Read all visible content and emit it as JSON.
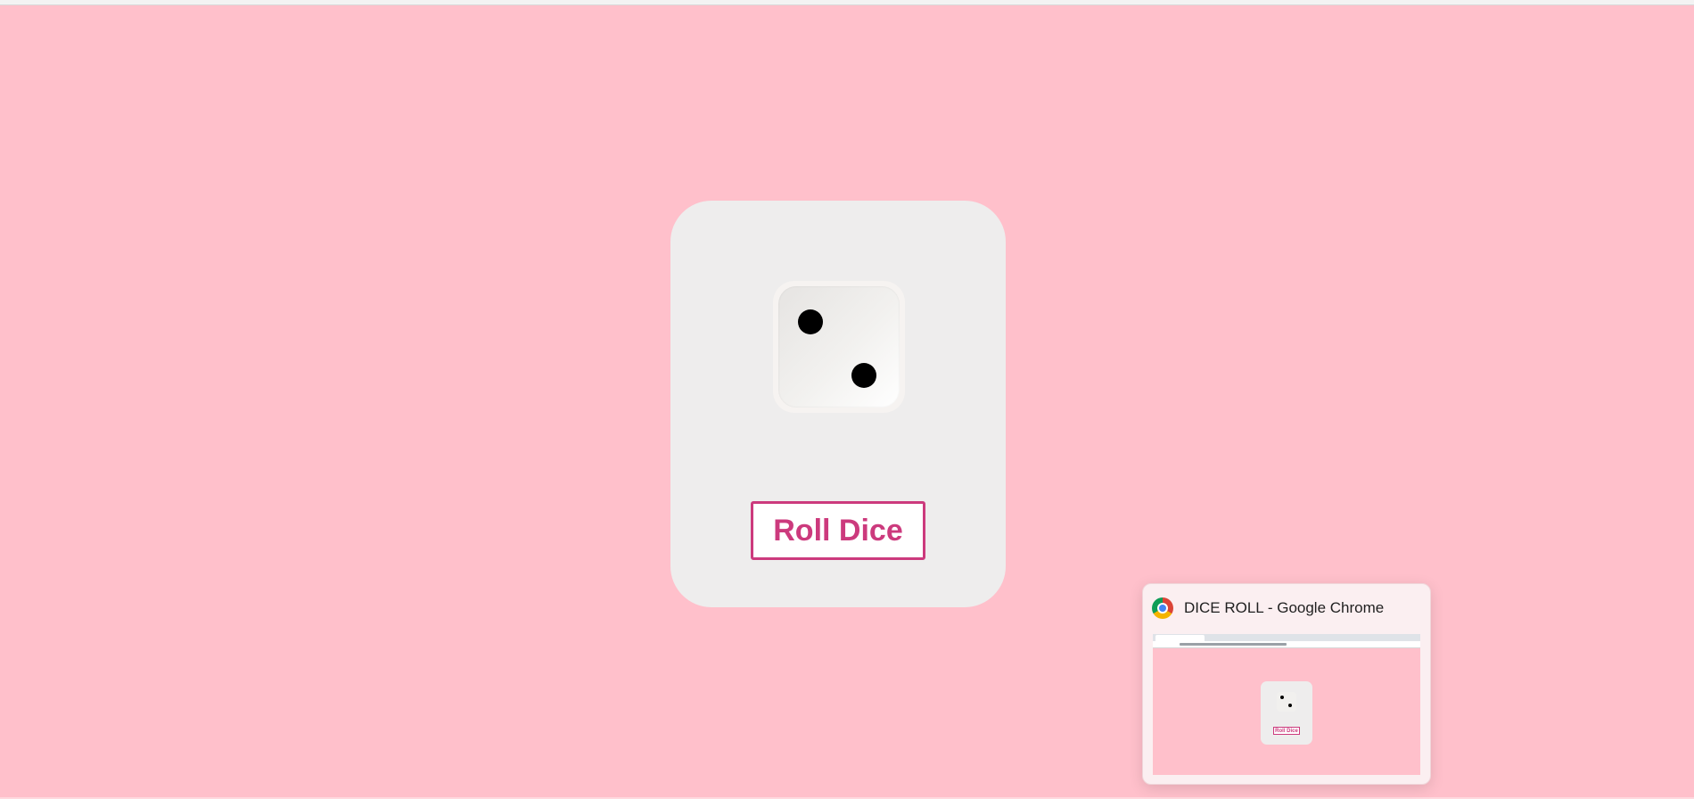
{
  "app": {
    "background_color": "#ffc0cb",
    "accent_color": "#cc3a7d"
  },
  "dice": {
    "value": 2,
    "roll_button_label": "Roll Dice"
  },
  "taskbar_preview": {
    "icon": "chrome-icon",
    "title": "DICE ROLL - Google Chrome",
    "thumbnail_button_label": "Roll Dice"
  }
}
